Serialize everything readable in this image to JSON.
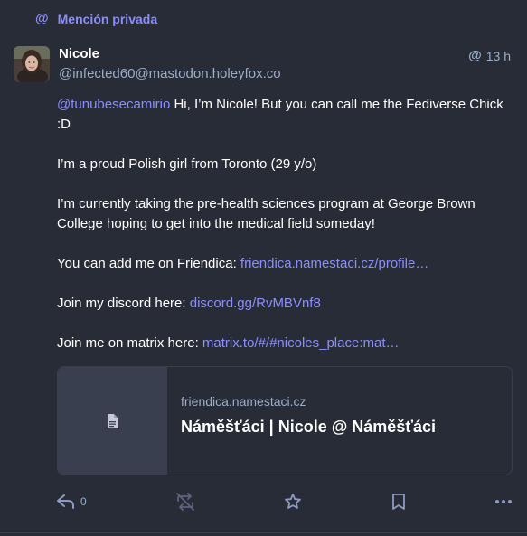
{
  "prepend": {
    "icon": "at-icon",
    "label": "Mención privada"
  },
  "author": {
    "display_name": "Nicole",
    "account": "@infected60@mastodon.holeyfox.co"
  },
  "meta": {
    "visibility_icon": "at-icon",
    "time": "13 h"
  },
  "content": {
    "mention": "@tunubesecamirio",
    "p1_text": " Hi, I’m Nicole! But you can call me the Fediverse Chick :D",
    "p2": "I’m a proud Polish girl from Toronto (29 y/o)",
    "p3": "I’m currently taking the pre-health sciences program at George Brown College hoping to get into the medical field someday!",
    "p4_prefix": "You can add me on Friendica: ",
    "p4_link": "friendica.namestaci.cz/profile…",
    "p5_prefix": "Join my discord here: ",
    "p5_link": "discord.gg/RvMBVnf8",
    "p6_prefix": "Join me on matrix here: ",
    "p6_link": "matrix.to/#/#nicoles_place:mat…"
  },
  "card": {
    "icon": "document-icon",
    "host": "friendica.namestaci.cz",
    "title": "Náměšťáci | Nicole @ Náměšťáci"
  },
  "actions": {
    "reply_count": "0"
  },
  "colors": {
    "background": "#282c37",
    "accent": "#8c8dff",
    "muted": "#9baec8",
    "border": "#393f4f"
  }
}
